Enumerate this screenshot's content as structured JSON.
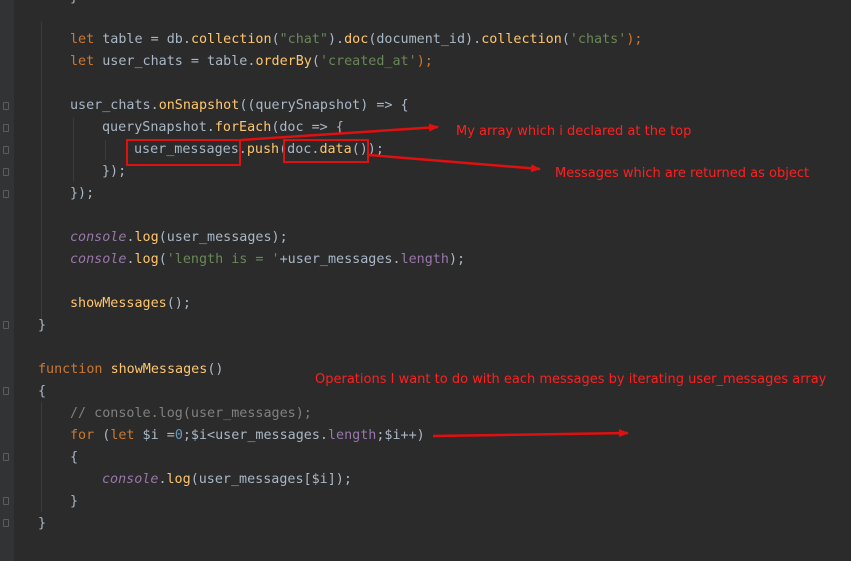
{
  "code": {
    "line0": "}",
    "l1_let": "let",
    "l1_a": " table = db.",
    "l1_collection": "collection",
    "l1_b": "(",
    "l1_str": "\"chat\"",
    "l1_c": ").",
    "l1_doc": "doc",
    "l1_d": "(document_id).",
    "l1_collection2": "collection",
    "l1_e": "(",
    "l1_str2": "'chats'",
    "l1_f": ");",
    "l2_let": "let",
    "l2_a": " user_chats = table.",
    "l2_orderBy": "orderBy",
    "l2_b": "(",
    "l2_str": "'created_at'",
    "l2_c": ");",
    "l4_a": "user_chats.",
    "l4_onSnapshot": "onSnapshot",
    "l4_b": "((querySnapshot) => {",
    "l5_a": "querySnapshot.",
    "l5_forEach": "forEach",
    "l5_b": "(doc => {",
    "l6_a": "user_messages.",
    "l6_push": "push",
    "l6_b": "(doc.",
    "l6_data": "data",
    "l6_c": "());",
    "l7": "});",
    "l8": "});",
    "l10_console": "console",
    "l10_dot": ".",
    "l10_log": "log",
    "l10_b": "(user_messages);",
    "l11_console": "console",
    "l11_dot": ".",
    "l11_log": "log",
    "l11_b": "(",
    "l11_str": "'length is = '",
    "l11_c": "+user_messages.",
    "l11_length": "length",
    "l11_d": ");",
    "l13_fn": "showMessages",
    "l13_b": "();",
    "l14": "}",
    "l16_kw": "function",
    "l16_sp": " ",
    "l16_fn": "showMessages",
    "l16_b": "()",
    "l17": "{",
    "l18_cm": "// console.log(user_messages);",
    "l19_for": "for",
    "l19_a": " (",
    "l19_let": "let",
    "l19_b": " $i =",
    "l19_num": "0",
    "l19_c": ";$i<user_messages.",
    "l19_length": "length",
    "l19_d": ";$i++)",
    "l20": "{",
    "l21_console": "console",
    "l21_dot": ".",
    "l21_log": "log",
    "l21_b": "(user_messages[$i]);",
    "l22": "}",
    "l23": "}"
  },
  "annotations": {
    "array_note": "My array which i declared at the top",
    "object_note": "Messages which are returned as object",
    "operations_note": "Operations I want to do with each messages by iterating user_messages array"
  },
  "colors": {
    "background": "#2b2b2b",
    "keyword": "#cc7832",
    "function": "#ffc66d",
    "property": "#9876aa",
    "string": "#6a8759",
    "comment": "#808080",
    "annotation": "#ff2020"
  }
}
